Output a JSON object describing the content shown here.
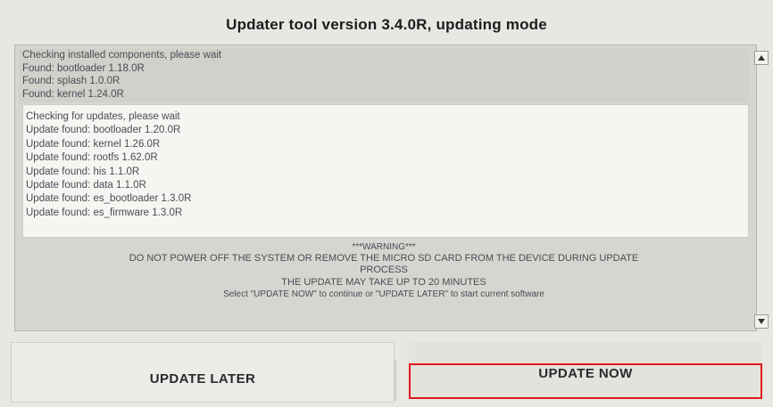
{
  "window": {
    "title": "Updater tool version 3.4.0R, updating mode"
  },
  "log": {
    "installed": [
      "Checking installed components, please wait",
      "Found: bootloader 1.18.0R",
      "Found: splash 1.0.0R",
      "Found: kernel 1.24.0R"
    ],
    "updates": [
      "Checking for updates, please wait",
      "Update found: bootloader 1.20.0R",
      "Update found: kernel 1.26.0R",
      "Update found: rootfs 1.62.0R",
      "Update found: his 1.1.0R",
      "Update found: data 1.1.0R",
      "Update found: es_bootloader 1.3.0R",
      "Update found: es_firmware 1.3.0R"
    ],
    "warning": {
      "heading": "***WARNING***",
      "line1": "DO NOT POWER OFF THE SYSTEM OR REMOVE THE MICRO SD CARD FROM THE DEVICE DURING UPDATE",
      "line2": "PROCESS",
      "line3": "THE UPDATE MAY TAKE UP TO 20 MINUTES",
      "line4": "Select \"UPDATE NOW\" to continue or \"UPDATE LATER\" to start current software"
    }
  },
  "scrollbar": {
    "up_icon": "triangle-up",
    "down_icon": "triangle-down"
  },
  "buttons": {
    "later_label": "UPDATE LATER",
    "now_label": "UPDATE NOW"
  },
  "colors": {
    "highlight_border": "#e0191e"
  }
}
